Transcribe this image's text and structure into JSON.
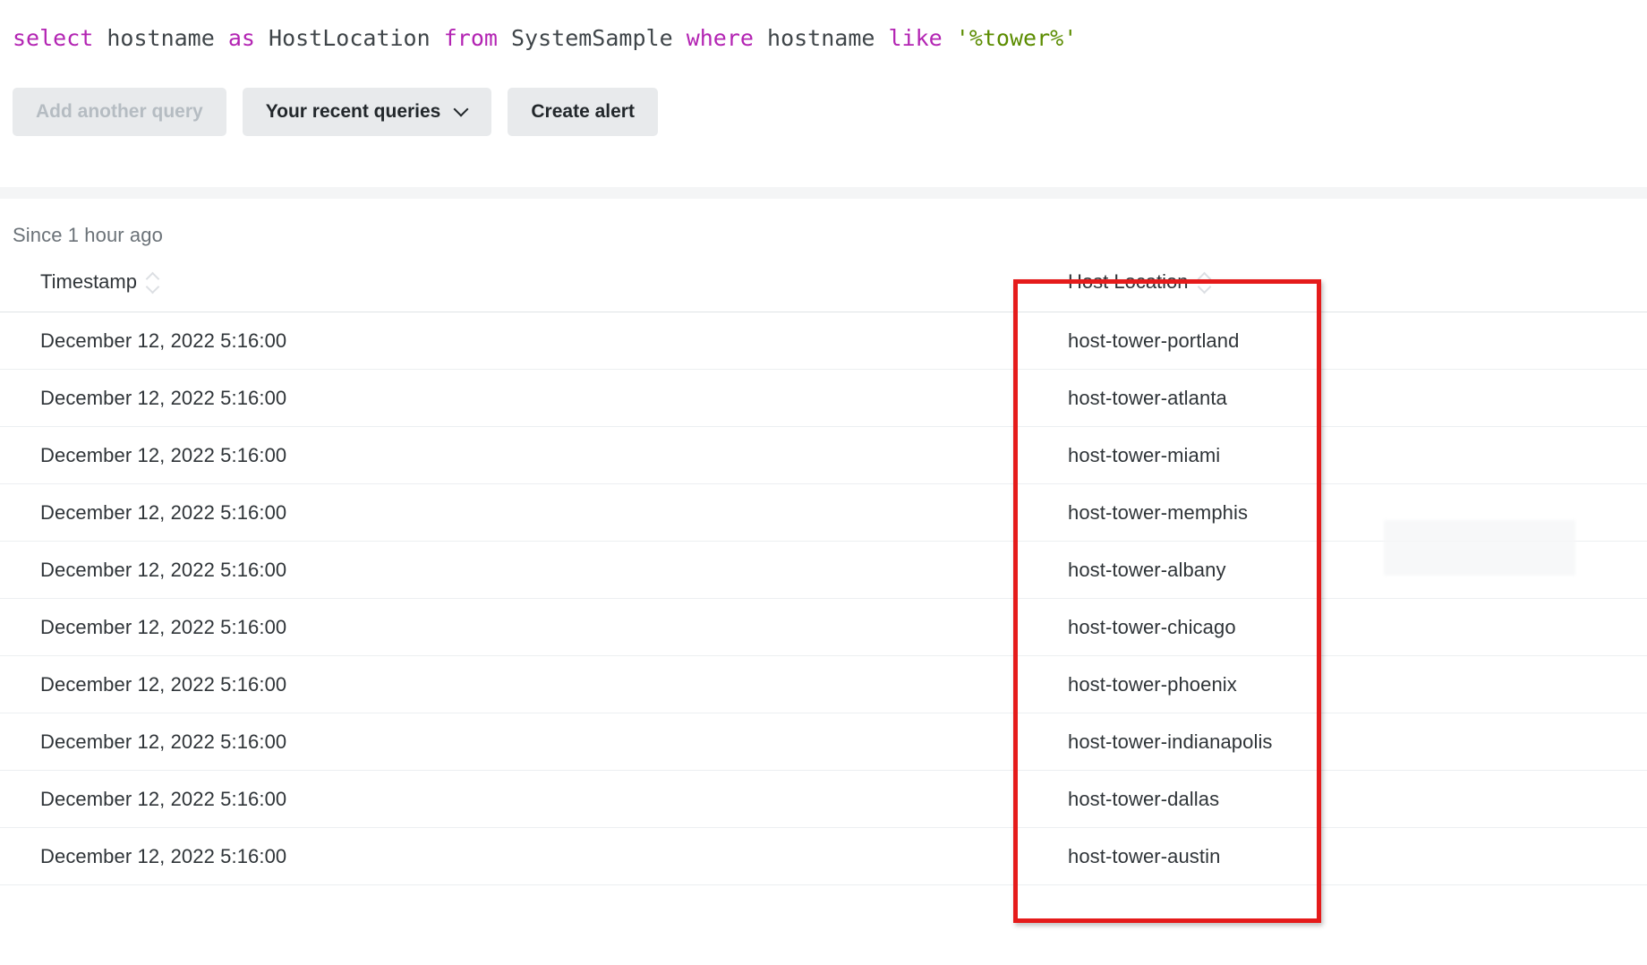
{
  "query": {
    "tokens": [
      {
        "text": "select",
        "type": "keyword"
      },
      {
        "text": " ",
        "type": "space"
      },
      {
        "text": "hostname",
        "type": "identifier"
      },
      {
        "text": " ",
        "type": "space"
      },
      {
        "text": "as",
        "type": "keyword"
      },
      {
        "text": " ",
        "type": "space"
      },
      {
        "text": "HostLocation",
        "type": "identifier"
      },
      {
        "text": " ",
        "type": "space"
      },
      {
        "text": "from",
        "type": "keyword"
      },
      {
        "text": " ",
        "type": "space"
      },
      {
        "text": "SystemSample",
        "type": "identifier"
      },
      {
        "text": " ",
        "type": "space"
      },
      {
        "text": "where",
        "type": "keyword"
      },
      {
        "text": " ",
        "type": "space"
      },
      {
        "text": "hostname",
        "type": "identifier"
      },
      {
        "text": " ",
        "type": "space"
      },
      {
        "text": "like",
        "type": "keyword"
      },
      {
        "text": " ",
        "type": "space"
      },
      {
        "text": "'%tower%'",
        "type": "string"
      }
    ],
    "plain": "select hostname as HostLocation from SystemSample where hostname like '%tower%'",
    "colors": {
      "keyword": "#b324b3",
      "identifier": "#3f4549",
      "string": "#5b8c00"
    }
  },
  "toolbar": {
    "add_query_label": "Add another query",
    "add_query_disabled": true,
    "recent_queries_label": "Your recent queries",
    "recent_queries_caret": "chevron-down",
    "create_alert_label": "Create alert"
  },
  "results": {
    "time_range_label": "Since 1 hour ago",
    "columns": [
      {
        "key": "timestamp",
        "label": "Timestamp",
        "sortable": true
      },
      {
        "key": "host_location",
        "label": "Host Location",
        "sortable": true
      }
    ],
    "rows": [
      {
        "timestamp": "December 12, 2022 5:16:00",
        "host_location": "host-tower-portland"
      },
      {
        "timestamp": "December 12, 2022 5:16:00",
        "host_location": "host-tower-atlanta"
      },
      {
        "timestamp": "December 12, 2022 5:16:00",
        "host_location": "host-tower-miami"
      },
      {
        "timestamp": "December 12, 2022 5:16:00",
        "host_location": "host-tower-memphis"
      },
      {
        "timestamp": "December 12, 2022 5:16:00",
        "host_location": "host-tower-albany"
      },
      {
        "timestamp": "December 12, 2022 5:16:00",
        "host_location": "host-tower-chicago"
      },
      {
        "timestamp": "December 12, 2022 5:16:00",
        "host_location": "host-tower-phoenix"
      },
      {
        "timestamp": "December 12, 2022 5:16:00",
        "host_location": "host-tower-indianapolis"
      },
      {
        "timestamp": "December 12, 2022 5:16:00",
        "host_location": "host-tower-dallas"
      },
      {
        "timestamp": "December 12, 2022 5:16:00",
        "host_location": "host-tower-austin"
      }
    ]
  },
  "annotation": {
    "highlight_color": "#e51b1b",
    "highlights_column": "Host Location"
  }
}
